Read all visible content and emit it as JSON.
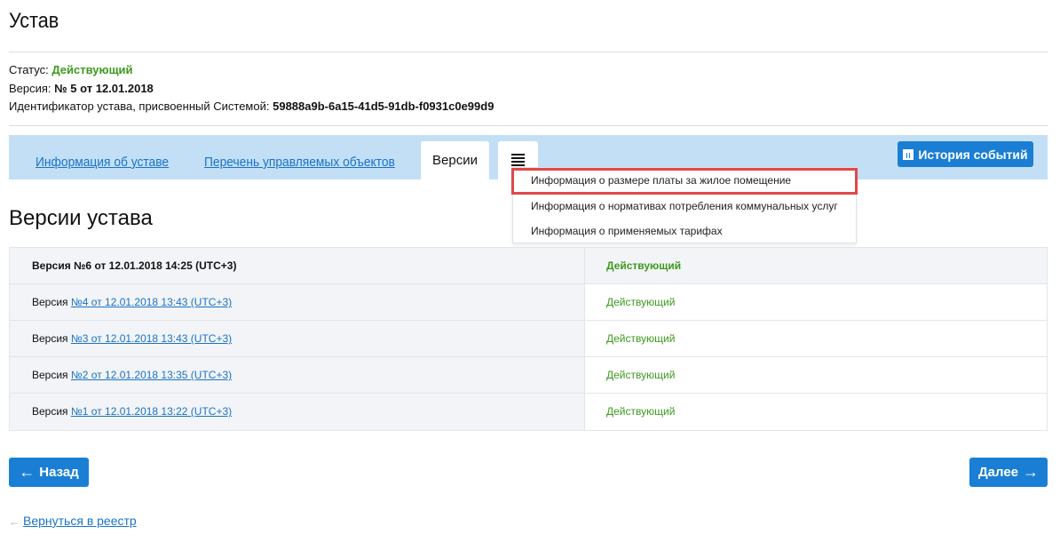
{
  "page_title": "Устав",
  "info": {
    "status_label": "Статус:",
    "status_value": "Действующий",
    "version_label": "Версия:",
    "version_value": "№ 5 от 12.01.2018",
    "id_label": "Идентификатор устава, присвоенный Системой:",
    "id_value": "59888a9b-6a15-41d5-91db-f0931c0e99d9"
  },
  "tabs": [
    {
      "label": "Информация об уставе"
    },
    {
      "label": "Перечень управляемых объектов"
    },
    {
      "label": "Версии"
    }
  ],
  "history_button": "История событий",
  "dropdown": [
    {
      "label": "Информация о размере платы за жилое помещение"
    },
    {
      "label": "Информация о нормативах потребления коммунальных услуг"
    },
    {
      "label": "Информация о применяемых тарифах"
    }
  ],
  "section_title": "Версии устава",
  "versions": [
    {
      "prefix": "Версия №6 от 12.01.2018 14:25 (UTC+3)",
      "status": "Действующий"
    },
    {
      "prefix": "Версия",
      "link": "№4 от 12.01.2018 13:43 (UTC+3)",
      "status": "Действующий"
    },
    {
      "prefix": "Версия",
      "link": "№3 от 12.01.2018 13:43 (UTC+3)",
      "status": "Действующий"
    },
    {
      "prefix": "Версия",
      "link": "№2 от 12.01.2018 13:35 (UTC+3)",
      "status": "Действующий"
    },
    {
      "prefix": "Версия",
      "link": "№1 от 12.01.2018 13:22 (UTC+3)",
      "status": "Действующий"
    }
  ],
  "back_button": "Назад",
  "next_button": "Далее",
  "return_link": "Вернуться в реестр"
}
